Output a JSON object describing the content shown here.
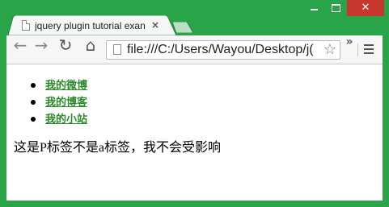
{
  "window": {
    "frame_color": "#2aa448",
    "close_color": "#c7372e"
  },
  "tab": {
    "title": "jquery plugin tutorial exan",
    "close_glyph": "×",
    "page_icon": "page-icon"
  },
  "toolbar": {
    "back_glyph": "←",
    "forward_glyph": "→",
    "reload_glyph": "↻",
    "home_glyph": "⌂",
    "url": "file:///C:/Users/Wayou/Desktop/j(",
    "star_glyph": "☆",
    "overflow_glyph": "»"
  },
  "page": {
    "links": [
      {
        "label": "我的微博"
      },
      {
        "label": "我的博客"
      },
      {
        "label": "我的小站"
      }
    ],
    "link_color": "#2a8a2a",
    "paragraph": "这是P标签不是a标签，我不会受影响"
  }
}
